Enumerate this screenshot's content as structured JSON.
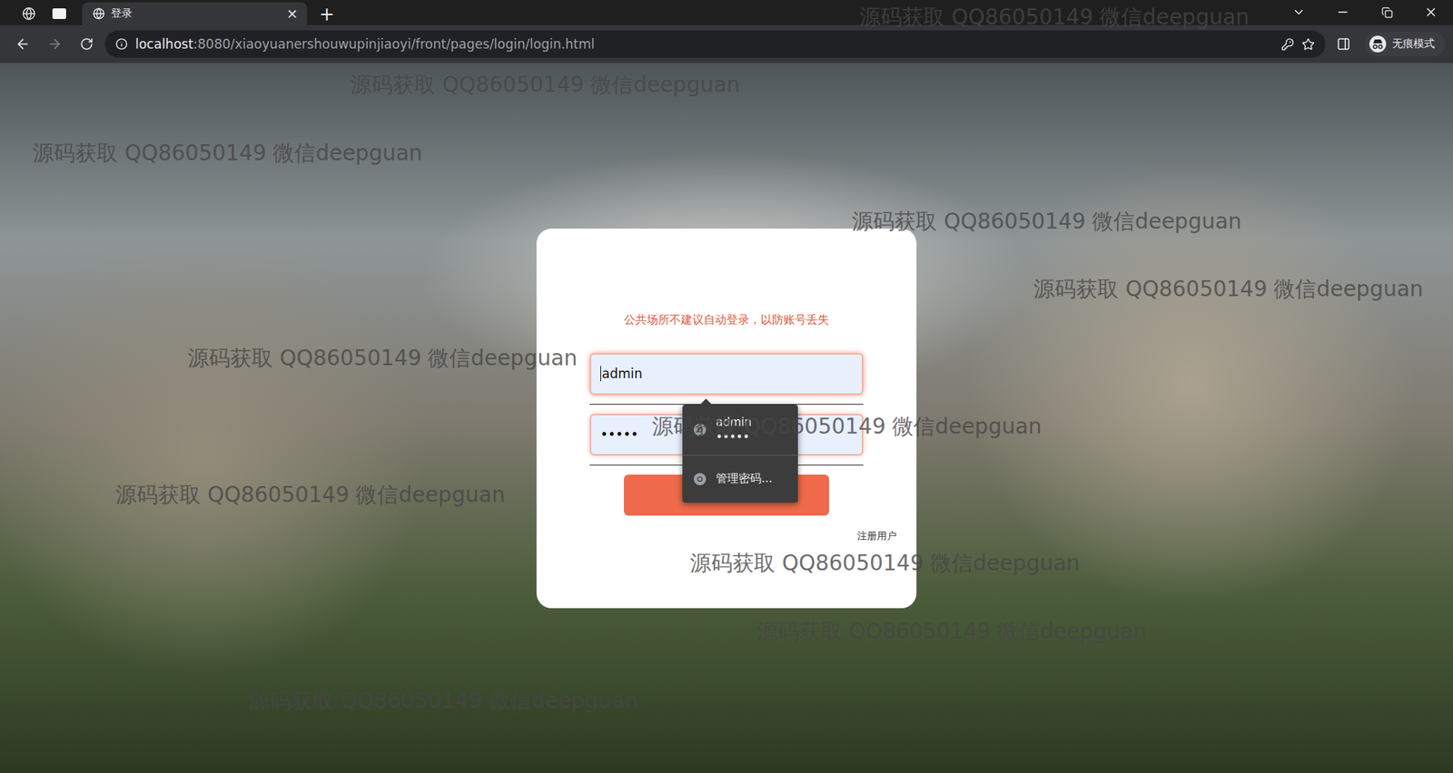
{
  "browser": {
    "tabs": [
      {
        "label": "登录",
        "selected": true,
        "close": "×"
      }
    ],
    "new_tab": "+",
    "url": {
      "host": "localhost",
      "rest": ":8080/xiaoyuanershouwupinjiaoyi/front/pages/login/login.html"
    },
    "profile": "无痕模式"
  },
  "login": {
    "notice": "公共场所不建议自动登录，以防账号丢失",
    "username": "admin",
    "username_focused": true,
    "password": "•••••",
    "register": "注册用户"
  },
  "autofill": {
    "entries": [
      {
        "username": "admin",
        "password": "•••••"
      }
    ],
    "manage": "管理密码..."
  },
  "watermarks": [
    "源码获取 QQ86050149 微信deepguan",
    "源码获取 QQ86050149 微信deepguan",
    "源码获取 QQ86050149 微信deepguan",
    "源码获取 QQ86050149 微信deepguan",
    "源码获取 QQ86050149 微信deepguan",
    "源码获取 QQ86050149 微信deepguan",
    "源码获取 QQ86050149 微信deepguan",
    "源码获取 QQ86050149 微信deepguan",
    "源码获取 QQ86050149 微信deepguan",
    "源码获取 QQ86050149 微信deepguan",
    "源码获取 QQ86050149 微信deepguan"
  ]
}
